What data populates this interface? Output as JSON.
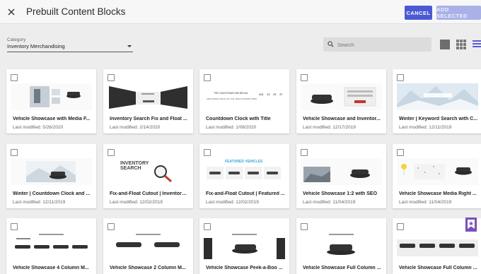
{
  "header": {
    "title": "Prebuilt Content Blocks",
    "cancel_label": "CANCEL",
    "add_selected_label": "ADD SELECTED"
  },
  "filters": {
    "category_label": "Category",
    "category_value": "Inventory Merchandising",
    "search_placeholder": "Search"
  },
  "cards": [
    {
      "title": "Vehicle Showcase with Media F...",
      "date": "Last modified: 5/26/2020"
    },
    {
      "title": "Inventory Search Fix and Float ...",
      "date": "Last modified: 2/14/2020"
    },
    {
      "title": "Countdown Clock with Title",
      "date": "Last modified: 1/08/2020"
    },
    {
      "title": "Vehicle Showcase and Inventor...",
      "date": "Last modified: 12/17/2019"
    },
    {
      "title": "Winter | Keyword Search with C...",
      "date": "Last modified: 12/11/2019"
    },
    {
      "title": "Winter | Countdown Clock and ...",
      "date": "Last modified: 12/11/2019"
    },
    {
      "title": "Fix-and-Float Cutout | Inventory ...",
      "date": "Last modified: 12/02/2019"
    },
    {
      "title": "Fix-and-Float Cutout | Featured ...",
      "date": "Last modified: 12/02/2019"
    },
    {
      "title": "Vehicle Showcase 1:2 with SEO",
      "date": "Last modified: 11/04/2019"
    },
    {
      "title": "Vehicle Showcase Media Right ...",
      "date": "Last modified: 11/04/2019"
    },
    {
      "title": "Vehicle Showcase 4 Column M...",
      "date": ""
    },
    {
      "title": "Vehicle Showcase 2 Column M...",
      "date": ""
    },
    {
      "title": "Vehicle Showcase Peek-a-Boo ...",
      "date": ""
    },
    {
      "title": "Vehicle Showcase Full Column ...",
      "date": ""
    },
    {
      "title": "Vehicle Showcase Full Column ...",
      "date": ""
    }
  ],
  "thumbnails": {
    "countdown_heading": "THE COUNTDOWN HAS BEGUN",
    "countdown_sub": "SEE MODEST DEALS OF THE YEAR IN MODEST BIKE",
    "countdown_digits": [
      "261",
      "13",
      "25",
      "37"
    ],
    "inventory_search_text": "INVENTORY SEARCH",
    "featured_vehicles_text": "FEATURED VEHICLES"
  },
  "colors": {
    "accent": "#4a5ad4",
    "accent_disabled": "#a9b1e6",
    "badge": "#7a4fb8"
  },
  "icons": {
    "close": "close-icon",
    "search": "search-icon",
    "grid_large": "large-grid-view-icon",
    "grid_small": "small-grid-view-icon",
    "list": "list-view-icon",
    "badge": "bookmark-star-icon"
  }
}
